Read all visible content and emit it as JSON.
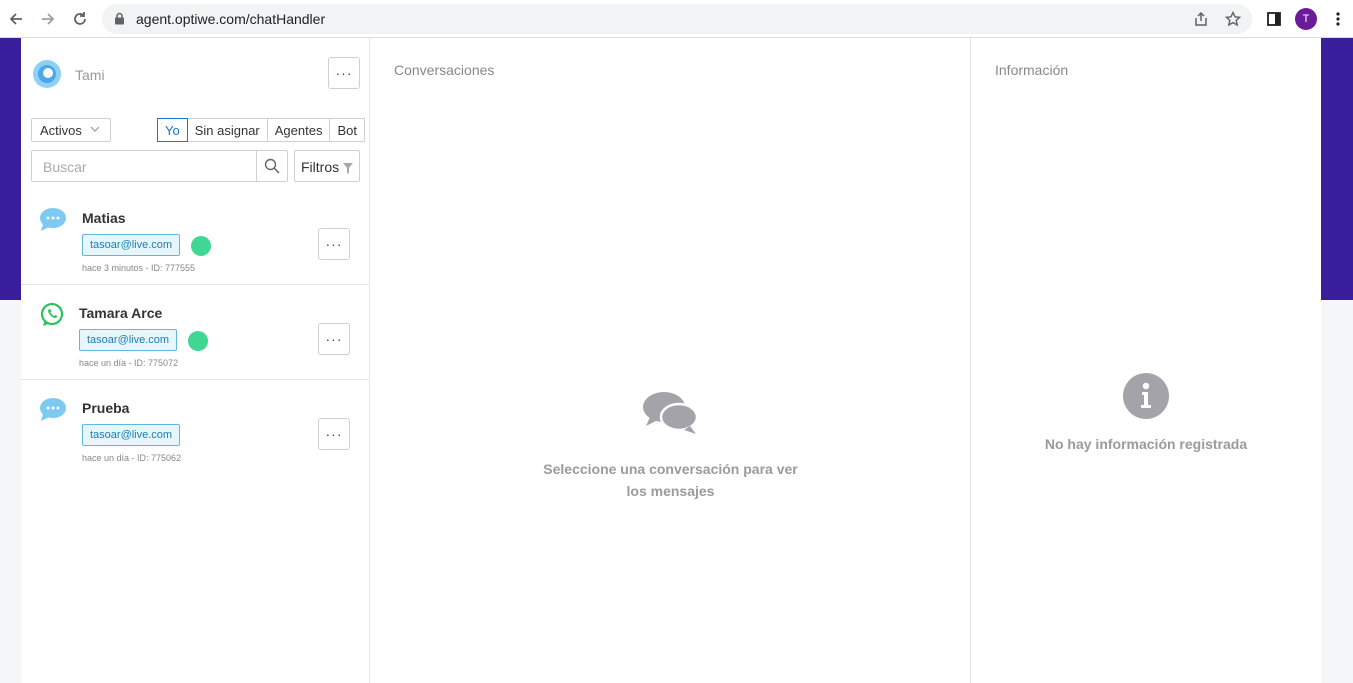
{
  "browser": {
    "url": "agent.optiwe.com/chatHandler",
    "profile_initial": "T"
  },
  "sidebar": {
    "agent_name": "Tami",
    "more_label": "···",
    "status_filter": "Activos",
    "tabs": [
      {
        "label": "Yo",
        "active": true
      },
      {
        "label": "Sin asignar",
        "active": false
      },
      {
        "label": "Agentes",
        "active": false
      },
      {
        "label": "Bot",
        "active": false
      }
    ],
    "search_placeholder": "Buscar",
    "filters_label": "Filtros"
  },
  "conversations": [
    {
      "channel": "chat-bubble-icon",
      "name": "Matias",
      "email": "tasoar@live.com",
      "online": true,
      "meta": "hace 3 minutos - ID: 777555"
    },
    {
      "channel": "whatsapp-icon",
      "name": "Tamara Arce",
      "email": "tasoar@live.com",
      "online": true,
      "meta": "hace un día - ID: 775072"
    },
    {
      "channel": "chat-bubble-icon",
      "name": "Prueba",
      "email": "tasoar@live.com",
      "online": false,
      "meta": "hace un día - ID: 775062"
    }
  ],
  "middle": {
    "title": "Conversaciones",
    "empty_message": "Seleccione una conversación para ver los mensajes"
  },
  "right": {
    "title": "Información",
    "empty_message": "No hay información registrada"
  },
  "colors": {
    "brand_purple": "#3a1f9c",
    "accent_blue": "#1976d2",
    "online_green": "#40d694",
    "email_tag_border": "#60b8e0"
  }
}
